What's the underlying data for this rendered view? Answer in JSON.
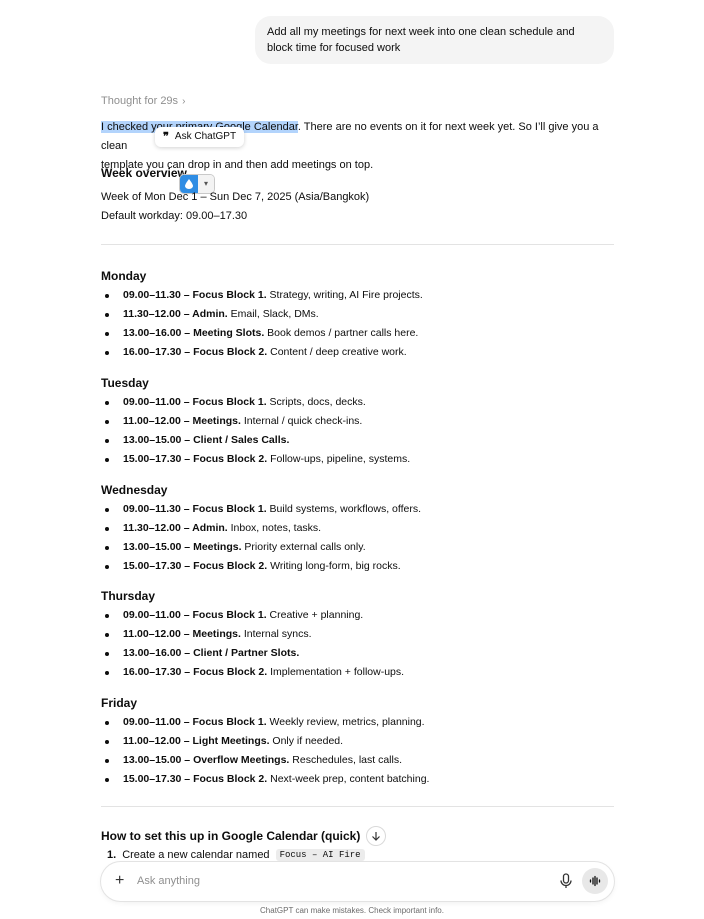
{
  "user_message": "Add all my meetings for next week into one clean schedule and block time for focused work",
  "thought": {
    "label": "Thought for 29s",
    "chevron": "›"
  },
  "intro": {
    "highlighted": "I checked your primary Google Calendar",
    "rest_line1": ". There are no events on it for next week yet. So I’ll give you a clean",
    "line2": "template you can drop in and then add meetings on top."
  },
  "popup": {
    "quote_icon": "❞",
    "label": "Ask ChatGPT"
  },
  "overview": {
    "title": "Week overview",
    "week": "Week of Mon Dec 1 – Sun Dec 7, 2025 (Asia/Bangkok)",
    "workday": "Default workday: 09.00–17.30"
  },
  "days": [
    {
      "name": "Monday",
      "items": [
        {
          "time": "09.00–11.30 – ",
          "title": "Focus Block 1.",
          "desc": " Strategy, writing, AI Fire projects."
        },
        {
          "time": "11.30–12.00 – ",
          "title": "Admin.",
          "desc": " Email, Slack, DMs."
        },
        {
          "time": "13.00–16.00 – ",
          "title": "Meeting Slots.",
          "desc": " Book demos / partner calls here."
        },
        {
          "time": "16.00–17.30 – ",
          "title": "Focus Block 2.",
          "desc": " Content / deep creative work."
        }
      ]
    },
    {
      "name": "Tuesday",
      "items": [
        {
          "time": "09.00–11.00 – ",
          "title": "Focus Block 1.",
          "desc": " Scripts, docs, decks."
        },
        {
          "time": "11.00–12.00 – ",
          "title": "Meetings.",
          "desc": " Internal / quick check-ins."
        },
        {
          "time": "13.00–15.00 – ",
          "title": "Client / Sales Calls.",
          "desc": ""
        },
        {
          "time": "15.00–17.30 – ",
          "title": "Focus Block 2.",
          "desc": " Follow-ups, pipeline, systems."
        }
      ]
    },
    {
      "name": "Wednesday",
      "items": [
        {
          "time": "09.00–11.30 – ",
          "title": "Focus Block 1.",
          "desc": " Build systems, workflows, offers."
        },
        {
          "time": "11.30–12.00 – ",
          "title": "Admin.",
          "desc": " Inbox, notes, tasks."
        },
        {
          "time": "13.00–15.00 – ",
          "title": "Meetings.",
          "desc": " Priority external calls only."
        },
        {
          "time": "15.00–17.30 – ",
          "title": "Focus Block 2.",
          "desc": " Writing long-form, big rocks."
        }
      ]
    },
    {
      "name": "Thursday",
      "items": [
        {
          "time": "09.00–11.00 – ",
          "title": "Focus Block 1.",
          "desc": " Creative + planning."
        },
        {
          "time": "11.00–12.00 – ",
          "title": "Meetings.",
          "desc": " Internal syncs."
        },
        {
          "time": "13.00–16.00 – ",
          "title": "Client / Partner Slots.",
          "desc": ""
        },
        {
          "time": "16.00–17.30 – ",
          "title": "Focus Block 2.",
          "desc": " Implementation + follow-ups."
        }
      ]
    },
    {
      "name": "Friday",
      "items": [
        {
          "time": "09.00–11.00 – ",
          "title": "Focus Block 1.",
          "desc": " Weekly review, metrics, planning."
        },
        {
          "time": "11.00–12.00 – ",
          "title": "Light Meetings.",
          "desc": " Only if needed."
        },
        {
          "time": "13.00–15.00 – ",
          "title": "Overflow Meetings.",
          "desc": " Reschedules, last calls."
        },
        {
          "time": "15.00–17.30 – ",
          "title": "Focus Block 2.",
          "desc": " Next-week prep, content batching."
        }
      ]
    }
  ],
  "how_to": {
    "title": "How to set this up in Google Calendar (quick)",
    "step1_num": "1.",
    "step1_text": "Create a new calendar named",
    "step1_code": "Focus – AI Fire"
  },
  "composer": {
    "placeholder": "Ask anything",
    "plus": "+"
  },
  "disclaimer": "ChatGPT can make mistakes. Check important info.",
  "colors": {
    "highlight": "#b3d4fc",
    "bubble": "#f4f4f4",
    "drop_widget": "#2f8de4"
  }
}
